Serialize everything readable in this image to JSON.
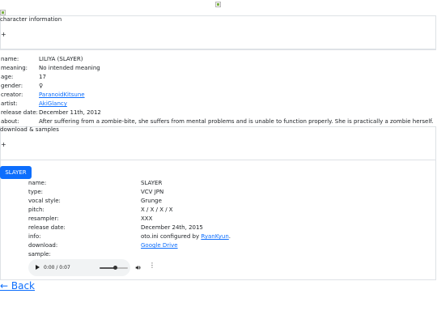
{
  "character": {
    "heading": "character information",
    "toggle": "+",
    "fields": [
      {
        "key": "name:",
        "value": "LILIYA (SLAYER)"
      },
      {
        "key": "meaning:",
        "value": "No intended meaning"
      },
      {
        "key": "age:",
        "value": "17"
      },
      {
        "key": "gender:",
        "value": "♀"
      },
      {
        "key": "creator:",
        "value": "ParanoidKitsune",
        "link": true
      },
      {
        "key": "artist:",
        "value": "AkiGlancy",
        "link": true
      },
      {
        "key": "release date:",
        "value": "December 11th, 2012"
      },
      {
        "key": "about:",
        "value": "After suffering from a zombie-bite, she suffers from mental problems and is unable to function properly. She is practically a zombie herself."
      }
    ]
  },
  "downloads": {
    "heading": "download & samples",
    "toggle": "+",
    "tab_label": "SLAYER",
    "fields": [
      {
        "key": "name:",
        "value": "SLAYER"
      },
      {
        "key": "type:",
        "value": "VCV JPN"
      },
      {
        "key": "vocal style:",
        "value": "Grunge"
      },
      {
        "key": "pitch:",
        "value": "X / X / X / X"
      },
      {
        "key": "resampler:",
        "value": "XXX"
      },
      {
        "key": "release date:",
        "value": "December 24th, 2015"
      },
      {
        "key": "info:",
        "value_prefix": "oto.ini configured by ",
        "value_link": "RyanKyun",
        "value_suffix": "."
      },
      {
        "key": "download:",
        "value": "Google Drive",
        "link": true
      },
      {
        "key": "sample:",
        "value": ""
      }
    ],
    "audio": {
      "time": "0:00 / 0:07",
      "progress": 0.55
    }
  },
  "nav": {
    "back_label": "← Back"
  }
}
